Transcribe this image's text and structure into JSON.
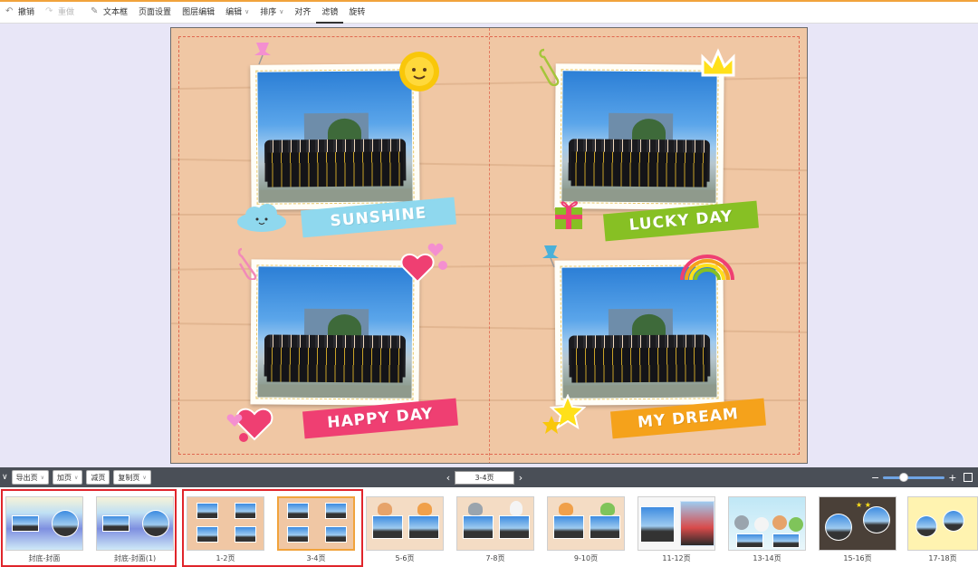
{
  "toolbar": {
    "undo": "撤销",
    "redo": "重做",
    "textbox": "文本框",
    "page_settings": "页面设置",
    "layer_edit": "图层编辑",
    "edit": "编辑",
    "sort": "排序",
    "align": "对齐",
    "filter": "滤镜",
    "rotate": "旋转"
  },
  "spread": {
    "banners": {
      "sunshine": "SUNSHINE",
      "lucky_day": "LUCKY DAY",
      "happy_day": "HAPPY DAY",
      "my_dream": "MY DREAM"
    },
    "colors": {
      "background": "#f0c7a4",
      "sunshine": "#8fd8ee",
      "lucky_day": "#87c024",
      "happy_day": "#ef3f72",
      "my_dream": "#f5a21b"
    }
  },
  "pagebar": {
    "export_page": "导出页",
    "add_page": "加页",
    "remove_page": "减页",
    "copy_page": "复制页",
    "current_page": "3-4页"
  },
  "thumbnails": [
    {
      "label": "封底-封面"
    },
    {
      "label": "封底-封面(1)"
    },
    {
      "label": "1-2页"
    },
    {
      "label": "3-4页"
    },
    {
      "label": "5-6页"
    },
    {
      "label": "7-8页"
    },
    {
      "label": "9-10页"
    },
    {
      "label": "11-12页"
    },
    {
      "label": "13-14页"
    },
    {
      "label": "15-16页"
    },
    {
      "label": "17-18页"
    }
  ]
}
